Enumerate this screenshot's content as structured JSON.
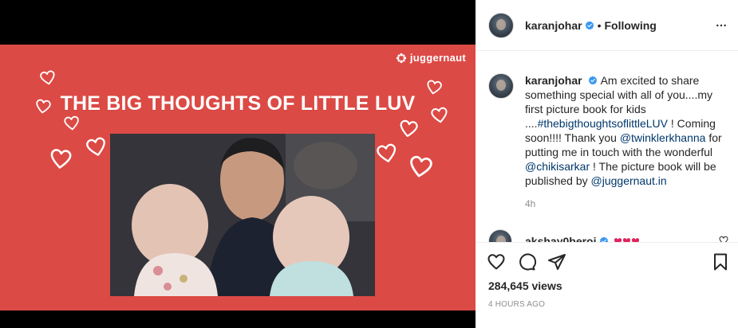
{
  "colors": {
    "poster_bg": "#dc4a45",
    "verified_blue": "#3897f0",
    "link_blue": "#00376b",
    "muted_text": "#8e8e8e"
  },
  "media": {
    "brand": "juggernaut",
    "title": "THE BIG THOUGHTS OF LITTLE LUV"
  },
  "header": {
    "username": "karanjohar",
    "separator": "•",
    "follow_state": "Following",
    "more_icon": "more-options-icon"
  },
  "caption": {
    "username": "karanjohar",
    "text_1": "Am excited to share something special with all of you....my first picture book for kids ....",
    "hashtag": "#thebigthoughtsoflittleLUV",
    "text_2": " ! Coming soon!!!! Thank you ",
    "mention_1": "@twinklerkhanna",
    "text_3": " for putting me in touch with the wonderful ",
    "mention_2": "@chikisarkar",
    "text_4": " ! The picture book will be published by ",
    "mention_3": "@juggernaut.in",
    "time_ago": "4h"
  },
  "comment": {
    "username": "akshay0beroi"
  },
  "actions": {
    "like_icon": "heart-icon",
    "comment_icon": "comment-icon",
    "share_icon": "share-icon",
    "save_icon": "bookmark-icon",
    "views": "284,645 views",
    "timestamp": "4 HOURS AGO"
  }
}
